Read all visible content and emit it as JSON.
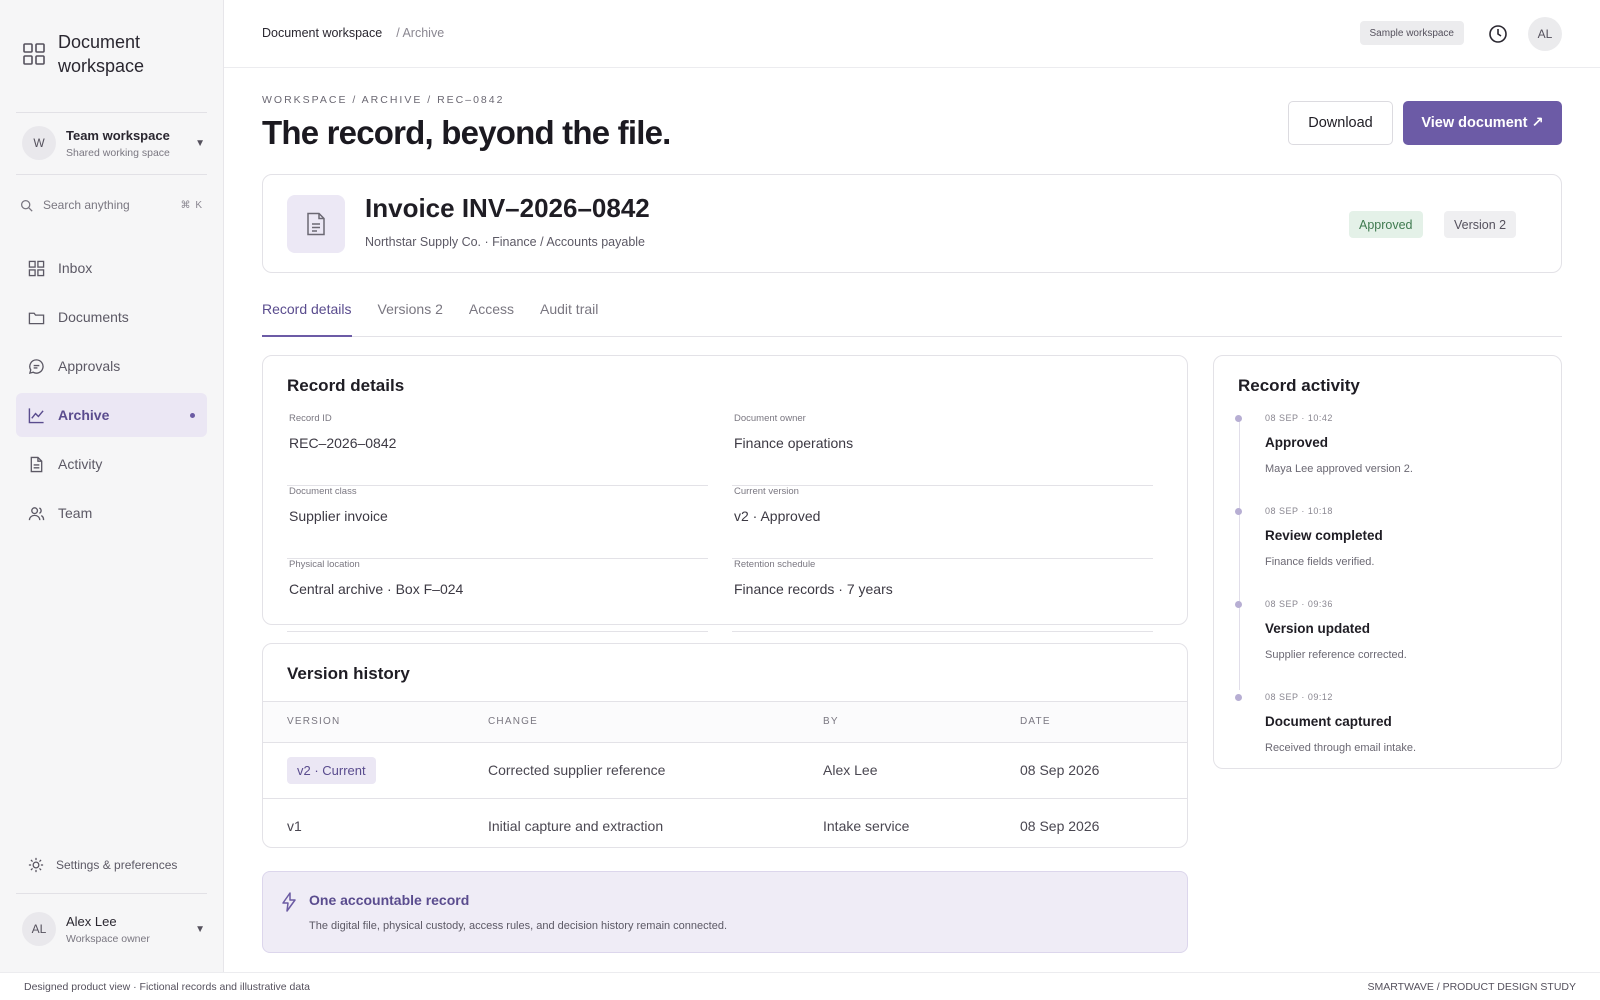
{
  "app": {
    "title": "Document workspace"
  },
  "workspace": {
    "avatar": "W",
    "name": "Team workspace",
    "subtitle": "Shared working space"
  },
  "search": {
    "placeholder": "Search anything",
    "shortcut": "⌘ K"
  },
  "nav": [
    {
      "label": "Inbox",
      "icon": "grid-icon"
    },
    {
      "label": "Documents",
      "icon": "folder-icon"
    },
    {
      "label": "Approvals",
      "icon": "chat-bubble-icon"
    },
    {
      "label": "Archive",
      "icon": "chart-line-icon",
      "active": true
    },
    {
      "label": "Activity",
      "icon": "file-icon"
    },
    {
      "label": "Team",
      "icon": "users-icon"
    }
  ],
  "settings": {
    "label": "Settings & preferences"
  },
  "user": {
    "initials": "AL",
    "name": "Alex Lee",
    "role": "Workspace owner"
  },
  "topbar": {
    "crumb_root": "Document workspace",
    "crumb_current": "/ Archive",
    "badge": "Sample workspace",
    "avatar": "AL"
  },
  "page": {
    "breadcrumb": "WORKSPACE / ARCHIVE / REC–0842",
    "title": "The record, beyond the file.",
    "download_label": "Download",
    "view_label": "View document ↗"
  },
  "document": {
    "title": "Invoice INV–2026–0842",
    "subtitle": "Northstar Supply Co. · Finance / Accounts payable",
    "status": "Approved",
    "version": "Version 2"
  },
  "tabs": [
    "Record details",
    "Versions 2",
    "Access",
    "Audit trail"
  ],
  "details": {
    "title": "Record details",
    "fields": [
      {
        "label": "Record ID",
        "value": "REC–2026–0842"
      },
      {
        "label": "Document owner",
        "value": "Finance operations"
      },
      {
        "label": "Document class",
        "value": "Supplier invoice"
      },
      {
        "label": "Current version",
        "value": "v2 · Approved"
      },
      {
        "label": "Physical location",
        "value": "Central archive · Box F–024"
      },
      {
        "label": "Retention schedule",
        "value": "Finance records · 7 years"
      }
    ]
  },
  "version_history": {
    "title": "Version history",
    "columns": [
      "VERSION",
      "CHANGE",
      "BY",
      "DATE"
    ],
    "rows": [
      {
        "version": "v2 · Current",
        "change": "Corrected supplier reference",
        "by": "Alex Lee",
        "date": "08 Sep 2026"
      },
      {
        "version": "v1",
        "change": "Initial capture and extraction",
        "by": "Intake service",
        "date": "08 Sep 2026"
      }
    ]
  },
  "callout": {
    "title": "One accountable record",
    "body": "The digital file, physical custody, access rules, and decision history remain connected."
  },
  "activity": {
    "title": "Record activity",
    "events": [
      {
        "time": "08 SEP · 10:42",
        "name": "Approved",
        "desc": "Maya Lee approved version 2."
      },
      {
        "time": "08 SEP · 10:18",
        "name": "Review completed",
        "desc": "Finance fields verified."
      },
      {
        "time": "08 SEP · 09:36",
        "name": "Version updated",
        "desc": "Supplier reference corrected."
      },
      {
        "time": "08 SEP · 09:12",
        "name": "Document captured",
        "desc": "Received through email intake."
      }
    ]
  },
  "footer": {
    "left": "Designed product view · Fictional records and illustrative data",
    "right": "SMARTWAVE / PRODUCT DESIGN STUDY"
  },
  "colors": {
    "accent": "#6c5ba6",
    "approved_bg": "#e4f1e8",
    "approved_text": "#3f7a4f",
    "callout_bg": "#efecf6"
  }
}
